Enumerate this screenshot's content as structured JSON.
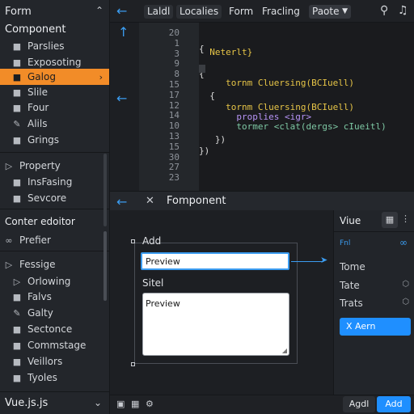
{
  "sidebar": {
    "header_title": "Form",
    "section_title": "Component",
    "items": [
      {
        "label": "Parslies",
        "icon": "folder-icon"
      },
      {
        "label": "Exposoting",
        "icon": "folder-icon"
      },
      {
        "label": "Galog",
        "icon": "folder-icon",
        "active": true
      },
      {
        "label": "Slile",
        "icon": "folder-icon"
      },
      {
        "label": "Four",
        "icon": "folder-icon"
      },
      {
        "label": "Alils",
        "icon": "pencil-icon"
      },
      {
        "label": "Grings",
        "icon": "folder-icon"
      }
    ],
    "property_title": "Property",
    "property_items": [
      {
        "label": "InsFasing",
        "icon": "folder-icon"
      },
      {
        "label": "Sevcore",
        "icon": "folder-icon"
      }
    ],
    "editor_title": "Conter edoitor",
    "editor_item": "Prefier",
    "fessige_title": "Fessige",
    "fessige_items": [
      {
        "label": "Orlowing",
        "icon": "play-icon"
      },
      {
        "label": "Falvs",
        "icon": "folder-icon"
      },
      {
        "label": "Galty",
        "icon": "pencil-icon"
      },
      {
        "label": "Sectonce",
        "icon": "folder-icon"
      },
      {
        "label": "Commstage",
        "icon": "folder-icon"
      },
      {
        "label": "Veillors",
        "icon": "folder-icon"
      },
      {
        "label": "Tyoles",
        "icon": "folder-icon"
      }
    ],
    "footer_label": "Vue.js.js"
  },
  "toolbar": {
    "tabs": [
      "Laldl",
      "Localies",
      "Form",
      "Fracling"
    ],
    "dropdown": "Paote"
  },
  "editor": {
    "line_numbers": [
      "20",
      "1",
      "3",
      "9",
      "8",
      "15",
      "17",
      "12",
      "14",
      "10",
      "13",
      "15",
      "30",
      "27",
      "23"
    ],
    "lines": [
      {
        "text": "{",
        "cls": "c-wht"
      },
      {
        "text": "  Neterlt}",
        "cls": "c-yel"
      },
      {
        "text": "{",
        "cls": "c-wht"
      },
      {
        "text": "     tornm Cluersing(BCIuell)",
        "cls": "c-yel"
      },
      {
        "text": "  {",
        "cls": "c-wht"
      },
      {
        "text": "     tornm Cluersing(BCIuell)",
        "cls": "c-yel"
      },
      {
        "text": "       proplies <igr>",
        "cls": "c-pur"
      },
      {
        "text": "       tormer <clat(dergs> cIueitl)",
        "cls": "c-grn"
      },
      {
        "text": "   })",
        "cls": "c-wht"
      },
      {
        "text": "})",
        "cls": "c-wht"
      }
    ]
  },
  "component": {
    "title": "Fomponent",
    "add_label": "Add",
    "input_value": "Preview",
    "sitel_label": "Sitel",
    "textarea_value": "Preview"
  },
  "inspector": {
    "title": "Viue",
    "fn_label": "Fnl",
    "rows": [
      "Tome",
      "Tate",
      "Trats"
    ],
    "button_label": "X Aern"
  },
  "bottom": {
    "btn_dark": "Agdl",
    "btn_blue": "Add"
  },
  "colors": {
    "accent": "#f28c28",
    "primary": "#1f8fff",
    "background": "#1b1d21"
  }
}
